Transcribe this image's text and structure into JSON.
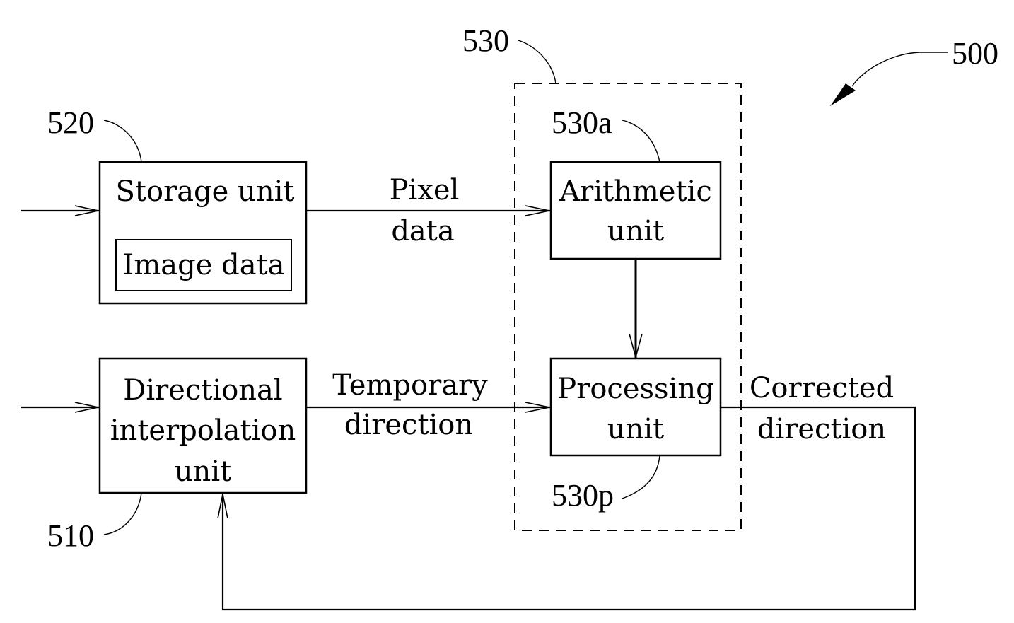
{
  "figure": {
    "reference": "500"
  },
  "group": {
    "reference": "530"
  },
  "blocks": {
    "storage": {
      "reference": "520",
      "label": "Storage unit",
      "inner_label": "Image data"
    },
    "interpolation": {
      "reference": "510",
      "lines": [
        "Directional",
        "interpolation",
        "unit"
      ]
    },
    "arithmetic": {
      "reference": "530a",
      "lines": [
        "Arithmetic",
        "unit"
      ]
    },
    "processing": {
      "reference": "530p",
      "lines": [
        "Processing",
        "unit"
      ]
    }
  },
  "signals": {
    "pixel_data": [
      "Pixel",
      "data"
    ],
    "temporary_direction": [
      "Temporary",
      "direction"
    ],
    "corrected_direction": [
      "Corrected",
      "direction"
    ]
  },
  "colors": {
    "ink": "#000000",
    "paper": "#ffffff"
  }
}
